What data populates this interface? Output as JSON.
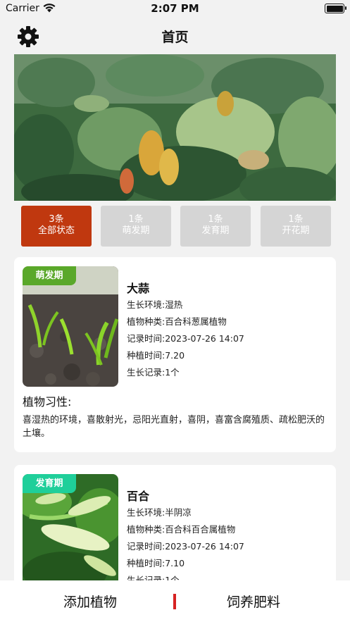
{
  "status_bar": {
    "carrier": "Carrier",
    "time": "2:07 PM"
  },
  "header": {
    "title": "首页",
    "settings_icon": "gear-icon"
  },
  "banner": {
    "image": "tropical-plants-illustration"
  },
  "tabs": [
    {
      "count": "3条",
      "label": "全部状态",
      "active": true
    },
    {
      "count": "1条",
      "label": "萌发期",
      "active": false
    },
    {
      "count": "1条",
      "label": "发育期",
      "active": false
    },
    {
      "count": "1条",
      "label": "开花期",
      "active": false
    }
  ],
  "plants": [
    {
      "badge": "萌发期",
      "badge_color": "#5aa82a",
      "name": "大蒜",
      "environment": "生长环境:湿热",
      "species": "植物种类:百合科葱属植物",
      "record_time": "记录时间:2023-07-26 14:07",
      "plant_time": "种植时间:7.20",
      "records": "生长记录:1个",
      "habit_title": "植物习性:",
      "habit": "喜湿热的环境，喜散射光，忌阳光直射，喜阴，喜富含腐殖质、疏松肥沃的土壤。"
    },
    {
      "badge": "发育期",
      "badge_color": "#1fcf9a",
      "name": "百合",
      "environment": "生长环境:半阴凉",
      "species": "植物种类:百合科百合属植物",
      "record_time": "记录时间:2023-07-26 14:07",
      "plant_time": "种植时间:7.10",
      "records": "生长记录:1个"
    }
  ],
  "bottom_bar": {
    "add_plant": "添加植物",
    "fertilize": "饲养肥料",
    "accent": "#d62222"
  }
}
